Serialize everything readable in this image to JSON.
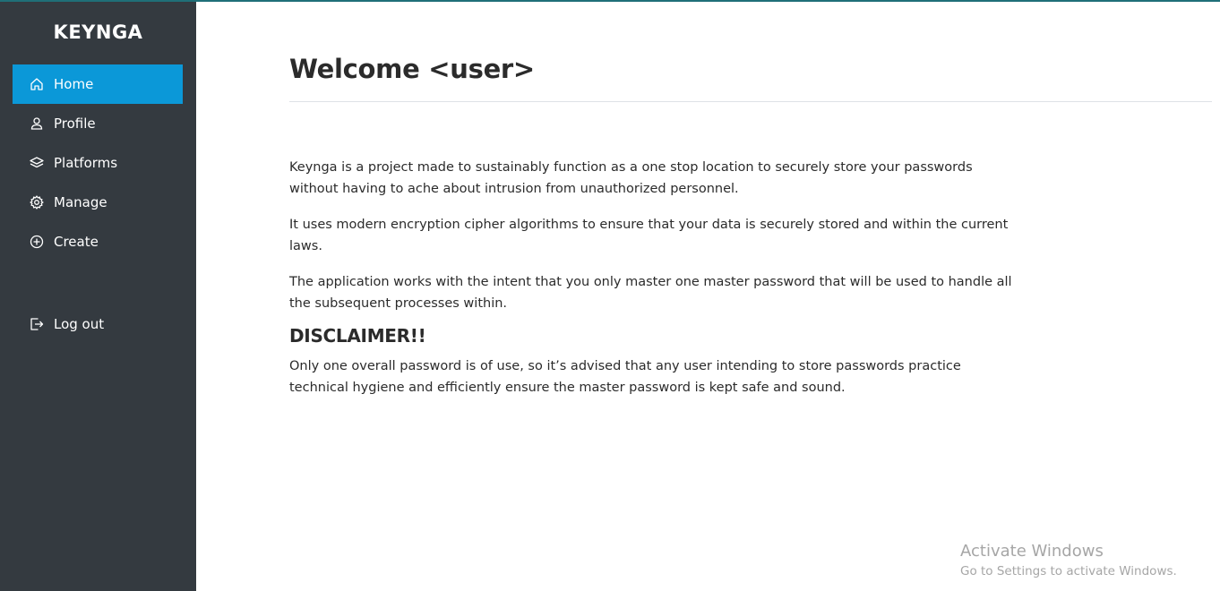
{
  "app": {
    "brand": "KEYNGA"
  },
  "sidebar": {
    "items": [
      {
        "label": "Home",
        "icon": "home-icon",
        "active": true
      },
      {
        "label": "Profile",
        "icon": "user-icon",
        "active": false
      },
      {
        "label": "Platforms",
        "icon": "layers-icon",
        "active": false
      },
      {
        "label": "Manage",
        "icon": "gear-icon",
        "active": false
      },
      {
        "label": "Create",
        "icon": "plus-circle-icon",
        "active": false
      },
      {
        "label": "Log out",
        "icon": "logout-icon",
        "active": false
      }
    ]
  },
  "main": {
    "title": "Welcome <user>",
    "paragraphs": [
      "Keynga is a project made to sustainably function as a one stop location to securely store your passwords without having to ache about intrusion from unauthorized personnel.",
      "It uses modern encryption cipher algorithms to ensure that your data is securely stored and within the current laws.",
      "The application works with the intent that you only master one master password that will be used to handle all the subsequent processes within."
    ],
    "disclaimer_title": "DISCLAIMER!!",
    "disclaimer_text": "Only one overall password is of use, so it’s advised that any user intending to store passwords practice technical hygiene and efficiently ensure the master password is kept safe and sound."
  },
  "watermark": {
    "title": "Activate Windows",
    "subtitle": "Go to Settings to activate Windows."
  },
  "colors": {
    "sidebar_bg": "#343a40",
    "active_item": "#0b98d8",
    "text": "#2b2b2b"
  }
}
